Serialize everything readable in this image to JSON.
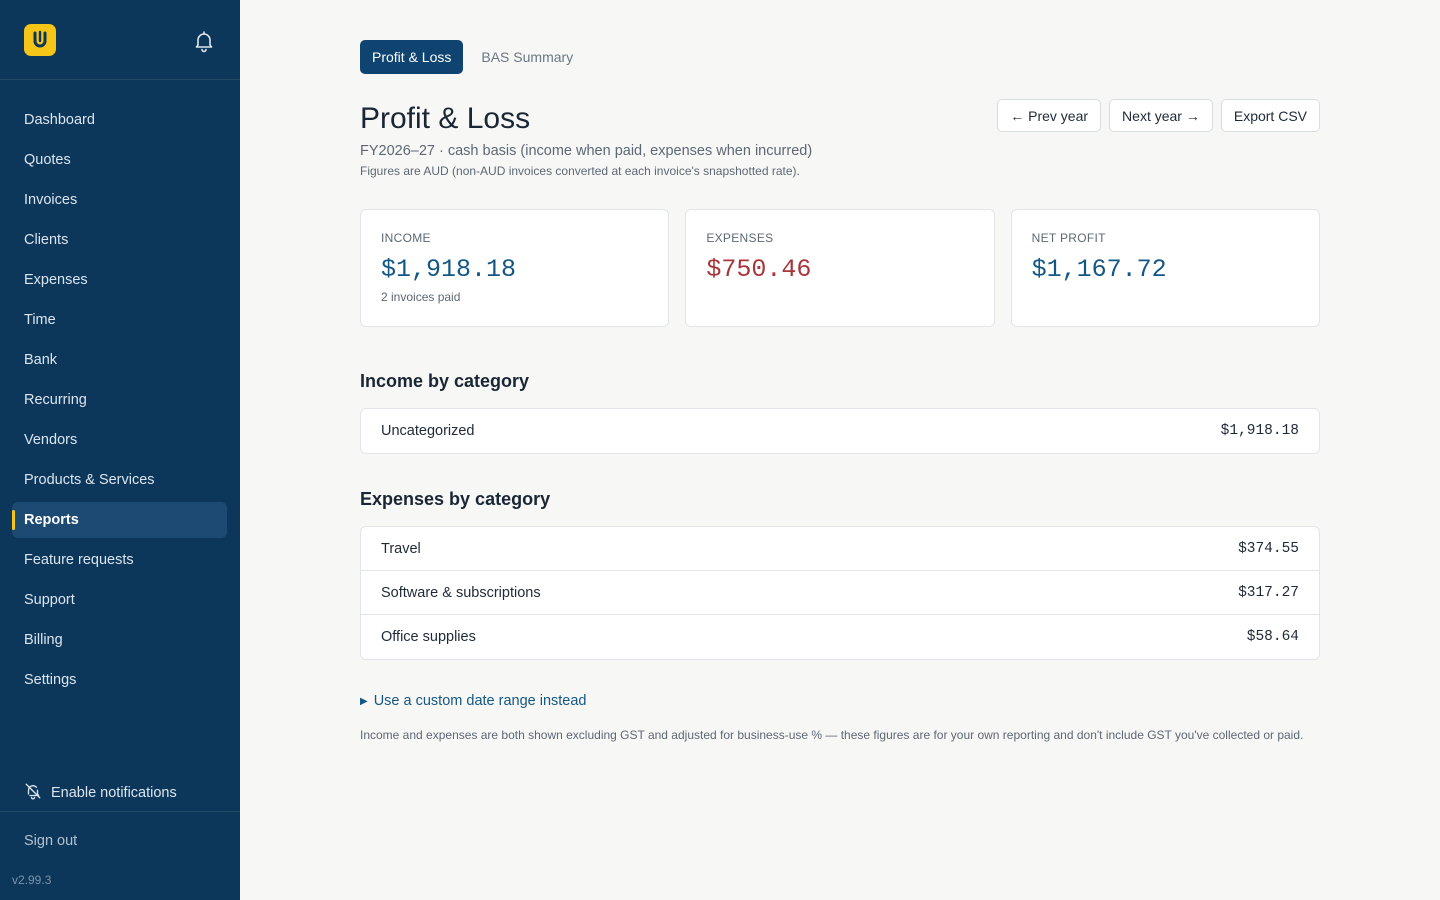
{
  "sidebar": {
    "logo_letter": "U",
    "items": [
      {
        "label": "Dashboard"
      },
      {
        "label": "Quotes"
      },
      {
        "label": "Invoices"
      },
      {
        "label": "Clients"
      },
      {
        "label": "Expenses"
      },
      {
        "label": "Time"
      },
      {
        "label": "Bank"
      },
      {
        "label": "Recurring"
      },
      {
        "label": "Vendors"
      },
      {
        "label": "Products & Services"
      },
      {
        "label": "Reports"
      },
      {
        "label": "Feature requests"
      },
      {
        "label": "Support"
      },
      {
        "label": "Billing"
      },
      {
        "label": "Settings"
      }
    ],
    "active_item": "Reports",
    "enable_notifications": "Enable notifications",
    "sign_out": "Sign out",
    "version": "v2.99.3"
  },
  "tabs": [
    {
      "label": "Profit & Loss",
      "active": true
    },
    {
      "label": "BAS Summary",
      "active": false
    }
  ],
  "header": {
    "title": "Profit & Loss",
    "prev_year": "← Prev year",
    "next_year": "Next year →",
    "export_csv": "Export CSV",
    "subtitle": "FY2026–27 · cash basis (income when paid, expenses when incurred)",
    "note": "Figures are AUD (non-AUD invoices converted at each invoice's snapshotted rate)."
  },
  "summary": {
    "income": {
      "label": "Income",
      "value": "$1,918.18",
      "sub": "2 invoices paid"
    },
    "expenses": {
      "label": "Expenses",
      "value": "$750.46"
    },
    "net_profit": {
      "label": "Net profit",
      "value": "$1,167.72"
    }
  },
  "income_by_category": {
    "title": "Income by category",
    "rows": [
      {
        "category": "Uncategorized",
        "amount": "$1,918.18"
      }
    ]
  },
  "expenses_by_category": {
    "title": "Expenses by category",
    "rows": [
      {
        "category": "Travel",
        "amount": "$374.55"
      },
      {
        "category": "Software & subscriptions",
        "amount": "$317.27"
      },
      {
        "category": "Office supplies",
        "amount": "$58.64"
      }
    ]
  },
  "custom_range": "Use a custom date range instead",
  "footer_note": "Income and expenses are both shown excluding GST and adjusted for business-use % — these figures are for your own reporting and don't include GST you've collected or paid.",
  "colors": {
    "sidebar_bg": "#0c365a",
    "accent_yellow": "#f5c518",
    "primary_blue": "#155784",
    "negative_red": "#a8353a"
  },
  "icons": {
    "logo": "app-logo-icon",
    "bell": "bell-icon",
    "notifications_off": "bell-off-icon",
    "disclosure": "triangle-right-icon"
  }
}
